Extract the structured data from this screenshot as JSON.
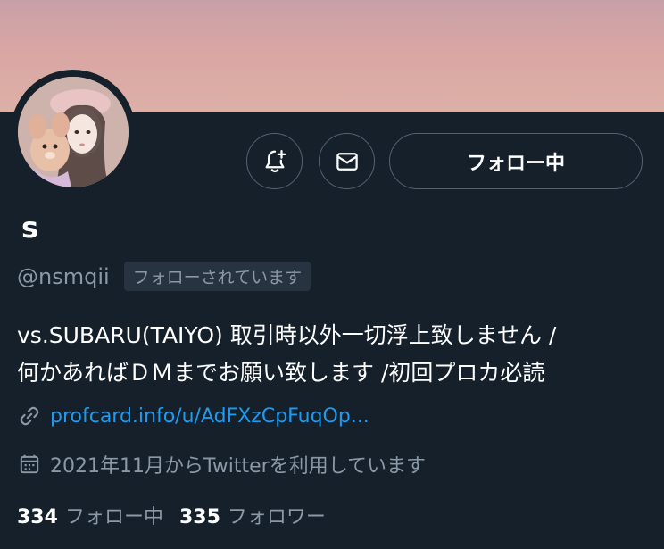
{
  "profile": {
    "display_name": "s",
    "handle": "@nsmqii",
    "follows_you_badge": "フォローされています"
  },
  "actions": {
    "follow_button_label": "フォロー中",
    "notify_icon": "bell-plus-icon",
    "message_icon": "envelope-icon"
  },
  "bio": {
    "line1": "vs.SUBARU(TAIYO) 取引時以外一切浮上致しません /",
    "line2": "何かあればＤＭまでお願い致します /初回プロカ必読"
  },
  "link": {
    "icon": "link-icon",
    "text": "profcard.info/u/AdFXzCpFuqOp..."
  },
  "joined": {
    "icon": "calendar-icon",
    "text": "2021年11月からTwitterを利用しています"
  },
  "stats": {
    "following_count": "334",
    "following_label": "フォロー中",
    "followers_count": "335",
    "followers_label": "フォロワー"
  },
  "colors": {
    "background": "#15202b",
    "secondary_text": "#8b98a5",
    "link": "#1d9bf0",
    "border": "#536471"
  }
}
